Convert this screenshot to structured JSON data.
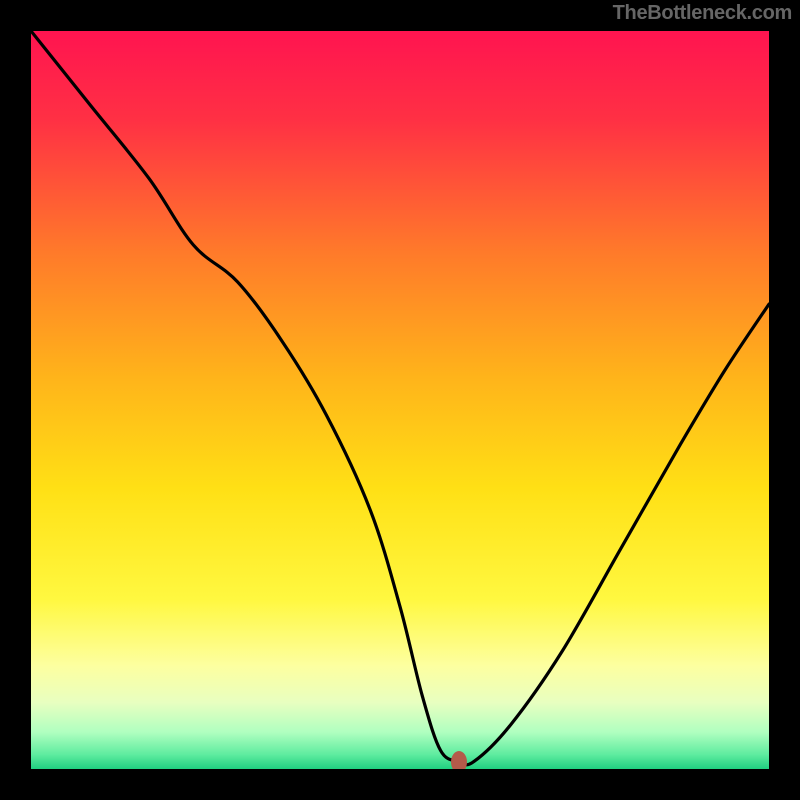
{
  "attribution": "TheBottleneck.com",
  "colors": {
    "bg": "#000000",
    "marker": "#b35a4a",
    "gradient_stops": [
      {
        "offset": "0%",
        "color": "#ff1450"
      },
      {
        "offset": "12%",
        "color": "#ff3044"
      },
      {
        "offset": "30%",
        "color": "#ff7a2a"
      },
      {
        "offset": "47%",
        "color": "#ffb41a"
      },
      {
        "offset": "62%",
        "color": "#ffe015"
      },
      {
        "offset": "77%",
        "color": "#fff840"
      },
      {
        "offset": "86%",
        "color": "#fdffa0"
      },
      {
        "offset": "91%",
        "color": "#e8ffc0"
      },
      {
        "offset": "95%",
        "color": "#b0ffc0"
      },
      {
        "offset": "98%",
        "color": "#60eca0"
      },
      {
        "offset": "100%",
        "color": "#20d080"
      }
    ]
  },
  "chart_data": {
    "type": "line",
    "title": "",
    "xlabel": "",
    "ylabel": "",
    "xlim": [
      0,
      100
    ],
    "ylim": [
      0,
      100
    ],
    "grid": false,
    "legend": false,
    "series": [
      {
        "name": "bottleneck-curve",
        "x": [
          0,
          8,
          16,
          22,
          28,
          34,
          40,
          46,
          50,
          53,
          55.5,
          58,
          60,
          65,
          72,
          80,
          88,
          94,
          100
        ],
        "y": [
          100,
          90,
          80,
          71,
          66,
          58,
          48,
          35,
          22,
          10,
          2.5,
          1,
          1,
          6,
          16,
          30,
          44,
          54,
          63
        ]
      }
    ],
    "annotations": [
      {
        "name": "optimal-marker",
        "x": 58,
        "y": 1
      }
    ]
  }
}
